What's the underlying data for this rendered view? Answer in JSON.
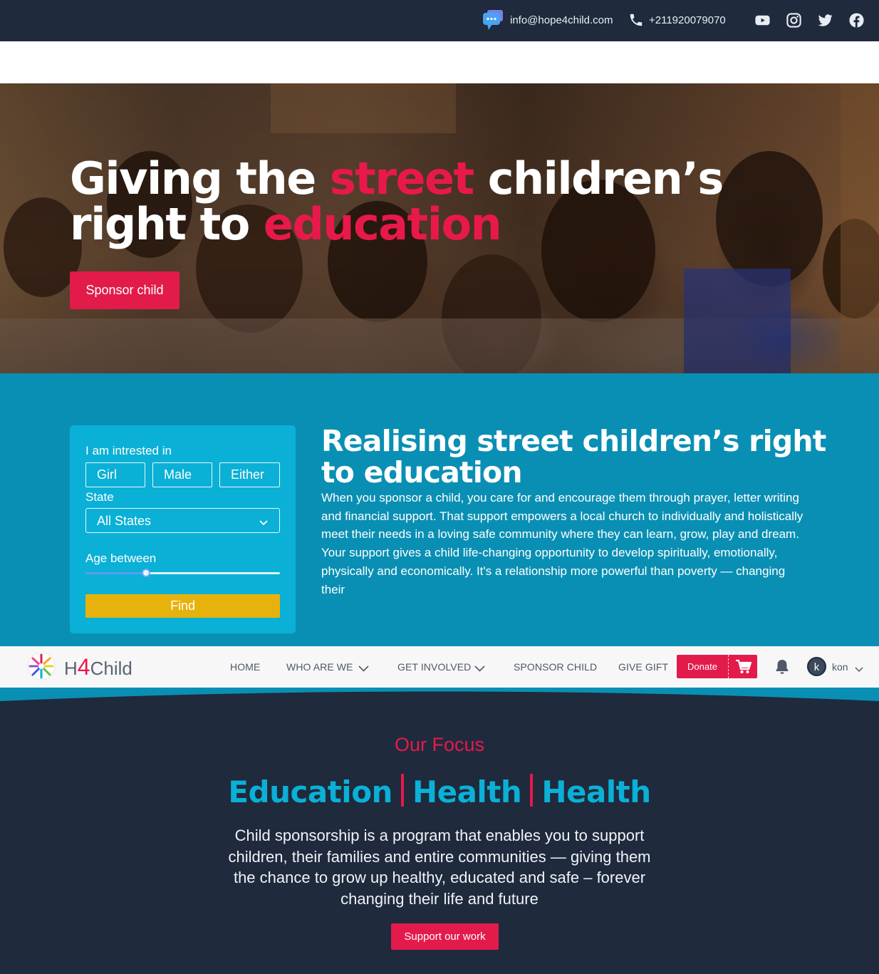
{
  "topbar": {
    "email": "info@hope4child.com",
    "phone": "+211920079070",
    "social_icons": [
      "youtube-icon",
      "instagram-icon",
      "twitter-icon",
      "facebook-icon"
    ]
  },
  "hero": {
    "title_part1": "Giving the ",
    "title_highlight1": "street",
    "title_part2": " children’s right to ",
    "title_highlight2": "education",
    "cta": "Sponsor child"
  },
  "finder": {
    "interest_label": "I am intrested in",
    "gender_options": [
      "Girl",
      "Male",
      "Either"
    ],
    "state_label": "State",
    "state_value": "All States",
    "age_label": "Age between",
    "age_range_fraction": [
      0,
      0.31
    ],
    "find_button": "Find"
  },
  "intro": {
    "heading": "Realising street children’s right to education",
    "body": "When you sponsor a child, you care for and encourage them through prayer, letter writing and financial support. That support empowers a local church to individually and holistically meet their needs in a loving safe community where they can learn, grow, play and dream. Your support gives a child life-changing opportunity to develop spiritually, emotionally, physically and economically. It's a relationship more powerful than poverty — changing their"
  },
  "nav": {
    "brand_prefix": "H",
    "brand_number": "4",
    "brand_suffix": "Child",
    "items": [
      "HOME",
      "WHO ARE WE",
      "GET INVOLVED",
      "SPONSOR CHILD",
      "GIVE GIFT"
    ],
    "donate": "Donate",
    "avatar_letter": "k",
    "username": "kon"
  },
  "focus": {
    "kicker": "Our Focus",
    "pillars": [
      "Education",
      "Health",
      "Health"
    ],
    "text": "Child sponsorship is a program that enables you to support children, their families and entire communities — giving them the chance to grow up healthy, educated and safe – forever changing their life and future",
    "cta": "Support our work"
  },
  "colors": {
    "accent_red": "#e31b4b",
    "teal": "#0a8fb4",
    "teal_light": "#0bb0d6",
    "navy": "#1f2a3d",
    "find_yellow": "#e8b20c"
  }
}
